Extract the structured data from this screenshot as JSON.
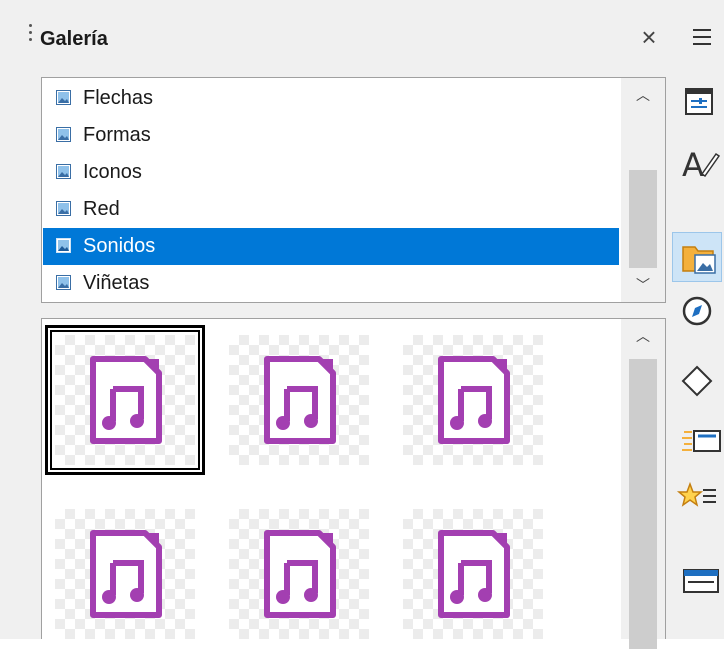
{
  "panel": {
    "title": "Galería"
  },
  "themes": {
    "items": [
      {
        "label": "Flechas",
        "selected": false
      },
      {
        "label": "Formas",
        "selected": false
      },
      {
        "label": "Iconos",
        "selected": false
      },
      {
        "label": "Red",
        "selected": false
      },
      {
        "label": "Sonidos",
        "selected": true
      },
      {
        "label": "Viñetas",
        "selected": false
      }
    ]
  },
  "gallery": {
    "items": [
      {
        "icon": "sound-file-icon",
        "selected": true
      },
      {
        "icon": "sound-file-icon",
        "selected": false
      },
      {
        "icon": "sound-file-icon",
        "selected": false
      },
      {
        "icon": "sound-file-icon",
        "selected": false
      },
      {
        "icon": "sound-file-icon",
        "selected": false
      },
      {
        "icon": "sound-file-icon",
        "selected": false
      }
    ]
  },
  "tabbar": {
    "tabs": [
      {
        "icon": "properties-icon",
        "active": false
      },
      {
        "icon": "styles-icon",
        "active": false
      },
      {
        "icon": "gallery-icon",
        "active": true
      },
      {
        "icon": "navigator-icon",
        "active": false
      },
      {
        "icon": "shapes-icon",
        "active": false
      },
      {
        "icon": "slide-transition-icon",
        "active": false
      },
      {
        "icon": "animation-icon",
        "active": false
      },
      {
        "icon": "master-slides-icon",
        "active": false
      }
    ]
  },
  "colors": {
    "selection": "#0078d7",
    "sound_icon": "#a33fb1",
    "active_tab": "#cde4f7"
  }
}
